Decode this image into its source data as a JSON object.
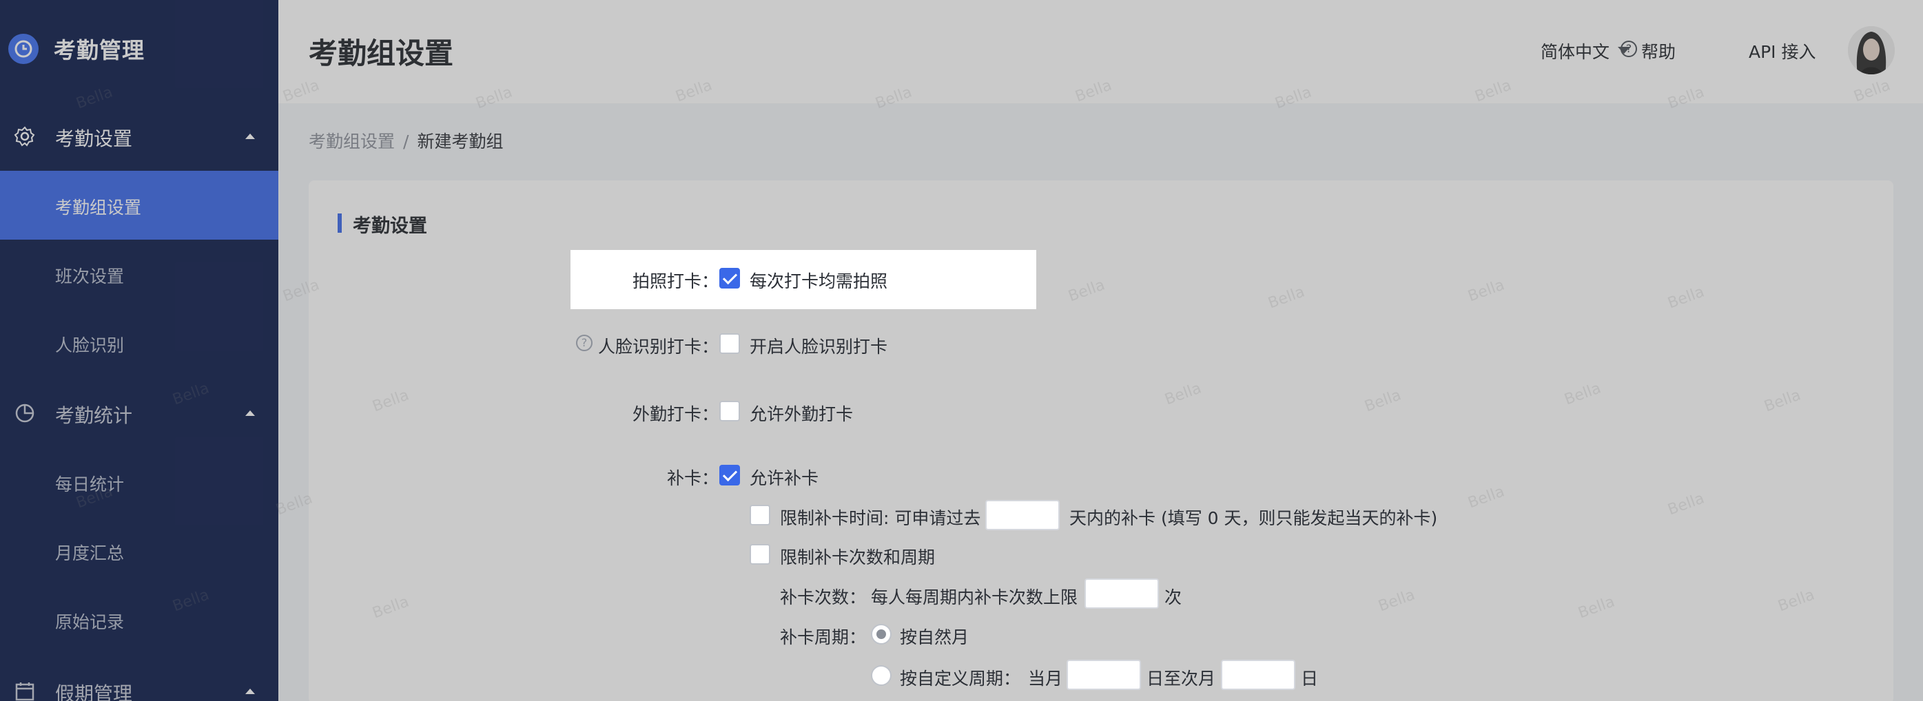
{
  "app": {
    "title": "考勤管理"
  },
  "sidebar": {
    "groups": [
      {
        "label": "考勤设置",
        "icon": "gear-icon",
        "items": [
          "考勤组设置",
          "班次设置",
          "人脸识别"
        ]
      },
      {
        "label": "考勤统计",
        "icon": "pie-chart-icon",
        "items": [
          "每日统计",
          "月度汇总",
          "原始记录"
        ]
      },
      {
        "label": "假期管理",
        "icon": "calendar-icon",
        "items": []
      }
    ],
    "active_item": "考勤组设置"
  },
  "header": {
    "page_title": "考勤组设置",
    "language": "简体中文",
    "help": "帮助",
    "api": "API 接入"
  },
  "breadcrumb": {
    "parent": "考勤组设置",
    "separator": "/",
    "current": "新建考勤组"
  },
  "section": {
    "title": "考勤设置"
  },
  "form": {
    "photo_label": "拍照打卡：",
    "photo_option": "每次打卡均需拍照",
    "photo_checked": true,
    "face_label": "人脸识别打卡：",
    "face_option": "开启人脸识别打卡",
    "face_checked": false,
    "outside_label": "外勤打卡：",
    "outside_option": "允许外勤打卡",
    "outside_checked": false,
    "makeup_label": "补卡：",
    "makeup_option": "允许补卡",
    "makeup_checked": true,
    "limit_time_prefix": "限制补卡时间: 可申请过去",
    "limit_time_suffix": "天内的补卡 (填写 0 天，则只能发起当天的补卡)",
    "limit_count_label": "限制补卡次数和周期",
    "count_label": "补卡次数：",
    "count_desc": "每人每周期内补卡次数上限",
    "count_unit": "次",
    "cycle_label": "补卡周期：",
    "cycle_natural": "按自然月",
    "cycle_custom": "按自定义周期：",
    "cycle_current_month": "当月",
    "cycle_day_to_next": "日至次月",
    "cycle_day": "日"
  },
  "watermark": "Bella",
  "colors": {
    "sidebar_bg": "#0b1a4a",
    "accent": "#3a68e8"
  }
}
